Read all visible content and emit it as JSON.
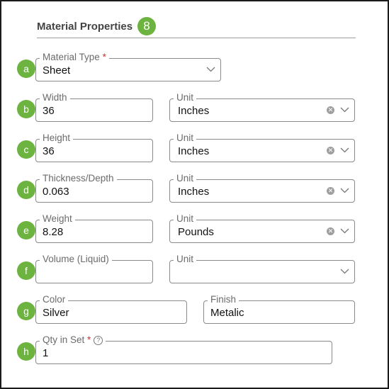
{
  "section": {
    "title": "Material Properties",
    "badge": "8"
  },
  "rows": {
    "a": {
      "badge": "a",
      "material_type": {
        "label": "Material Type",
        "required": "*",
        "value": "Sheet"
      }
    },
    "b": {
      "badge": "b",
      "width": {
        "label": "Width",
        "value": "36"
      },
      "unit": {
        "label": "Unit",
        "value": "Inches"
      }
    },
    "c": {
      "badge": "c",
      "height": {
        "label": "Height",
        "value": "36"
      },
      "unit": {
        "label": "Unit",
        "value": "Inches"
      }
    },
    "d": {
      "badge": "d",
      "thickness": {
        "label": "Thickness/Depth",
        "value": "0.063"
      },
      "unit": {
        "label": "Unit",
        "value": "Inches"
      }
    },
    "e": {
      "badge": "e",
      "weight": {
        "label": "Weight",
        "value": "8.28"
      },
      "unit": {
        "label": "Unit",
        "value": "Pounds"
      }
    },
    "f": {
      "badge": "f",
      "volume": {
        "label": "Volume (Liquid)",
        "value": ""
      },
      "unit": {
        "label": "Unit",
        "value": ""
      }
    },
    "g": {
      "badge": "g",
      "color": {
        "label": "Color",
        "value": "Silver"
      },
      "finish": {
        "label": "Finish",
        "value": "Metalic"
      }
    },
    "h": {
      "badge": "h",
      "qty": {
        "label": "Qty in Set",
        "required": "*",
        "help": "?",
        "value": "1"
      }
    }
  },
  "icons": {
    "clear": "clear-icon",
    "dropdown": "chevron-down-icon",
    "help": "help-circle-icon"
  },
  "colors": {
    "badge": "#6db33f",
    "required": "#d32f2f",
    "border": "#8a8a8a"
  }
}
